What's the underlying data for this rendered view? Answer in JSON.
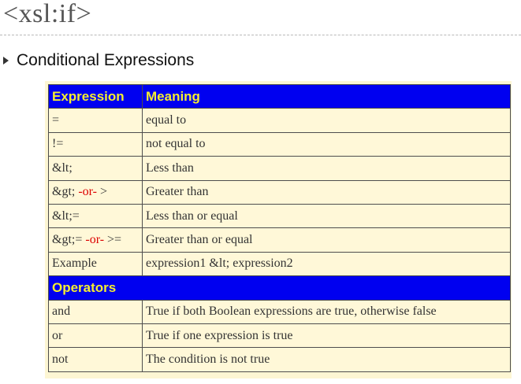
{
  "slide": {
    "title": "<xsl:if>",
    "bullet": "Conditional Expressions"
  },
  "table": {
    "header": [
      "Expression",
      "Meaning"
    ],
    "rows": [
      {
        "expr": [
          "="
        ],
        "meaning": "equal to"
      },
      {
        "expr": [
          "!="
        ],
        "meaning": "not equal to"
      },
      {
        "expr": [
          "&lt;"
        ],
        "meaning": "Less than"
      },
      {
        "expr": [
          "&gt; ",
          "-or-",
          " >"
        ],
        "meaning": "Greater than"
      },
      {
        "expr": [
          "&lt;="
        ],
        "meaning": "Less than or equal"
      },
      {
        "expr": [
          "&gt;= ",
          "-or-",
          " >="
        ],
        "meaning": "Greater than or equal"
      },
      {
        "expr": [
          "Example"
        ],
        "meaning": "expression1 &lt; expression2"
      }
    ],
    "operators_header": "Operators",
    "operators": [
      {
        "op": "and",
        "meaning": "True if both Boolean expressions are true, otherwise false"
      },
      {
        "op": "or",
        "meaning": "True if one expression is true"
      },
      {
        "op": "not",
        "meaning": "The condition is not true"
      }
    ]
  },
  "colors": {
    "header_bg": "#0000f0",
    "header_text": "#f5ee30",
    "cell_bg": "#fff8d8",
    "highlight": "#dd0000"
  }
}
